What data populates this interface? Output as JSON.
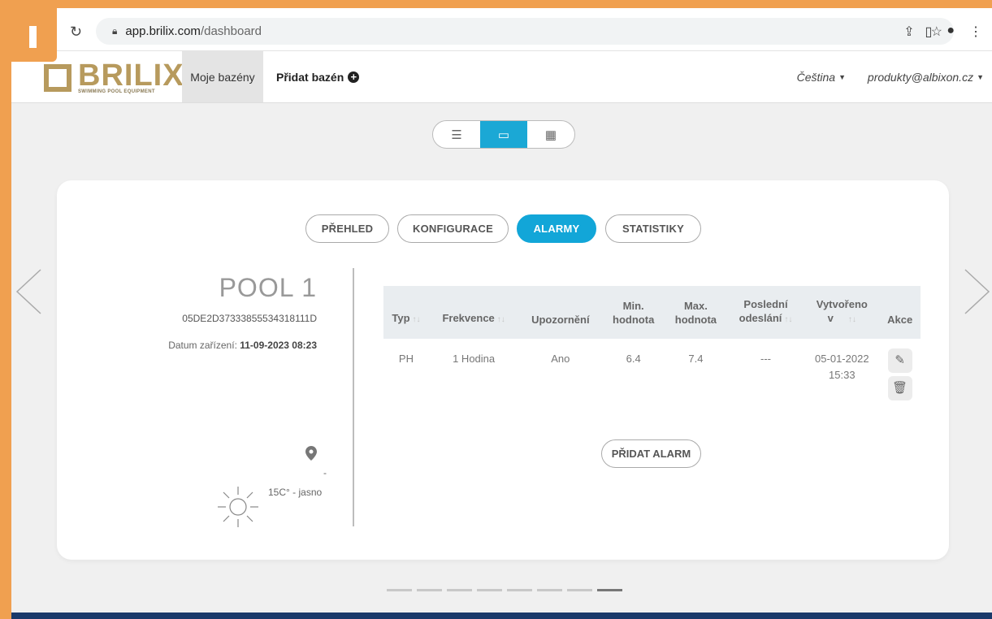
{
  "browser": {
    "url_host": "app.brilix.com",
    "url_path": "/dashboard"
  },
  "logo": {
    "name": "BRILIX",
    "tagline": "SWIMMING POOL EQUIPMENT"
  },
  "nav": {
    "moje_bazeny": "Moje bazény",
    "pridat_bazen": "Přidat bazén",
    "language": "Čeština",
    "user": "produkty@albixon.cz"
  },
  "tabs": {
    "prehled": "PŘEHLED",
    "konfigurace": "KONFIGURACE",
    "alarmy": "ALARMY",
    "statistiky": "STATISTIKY"
  },
  "pool": {
    "name": "POOL 1",
    "id": "05DE2D37333855534318111D",
    "date_label": "Datum zařízení:",
    "date_value": "11-09-2023 08:23",
    "location": "-",
    "weather": "15C° - jasno"
  },
  "table": {
    "headers": {
      "typ": "Typ",
      "frekvence": "Frekvence",
      "upozorneni": "Upozornění",
      "min_line1": "Min.",
      "min_line2": "hodnota",
      "max_line1": "Max.",
      "max_line2": "hodnota",
      "posledni_line1": "Poslední",
      "posledni_line2": "odeslání",
      "vytvoreno_line1": "Vytvořeno",
      "vytvoreno_line2": "v",
      "akce": "Akce"
    },
    "rows": [
      {
        "typ": "PH",
        "frekvence": "1 Hodina",
        "upozorneni": "Ano",
        "min": "6.4",
        "max": "7.4",
        "posledni": "---",
        "vytvoreno_date": "05-01-2022",
        "vytvoreno_time": "15:33"
      }
    ]
  },
  "add_alarm": "PŘIDAT ALARM",
  "pagination": {
    "total": 8,
    "active_index": 7
  },
  "colors": {
    "accent": "#12a6d8",
    "brand": "#b79a5d",
    "frame": "#f0a050"
  }
}
